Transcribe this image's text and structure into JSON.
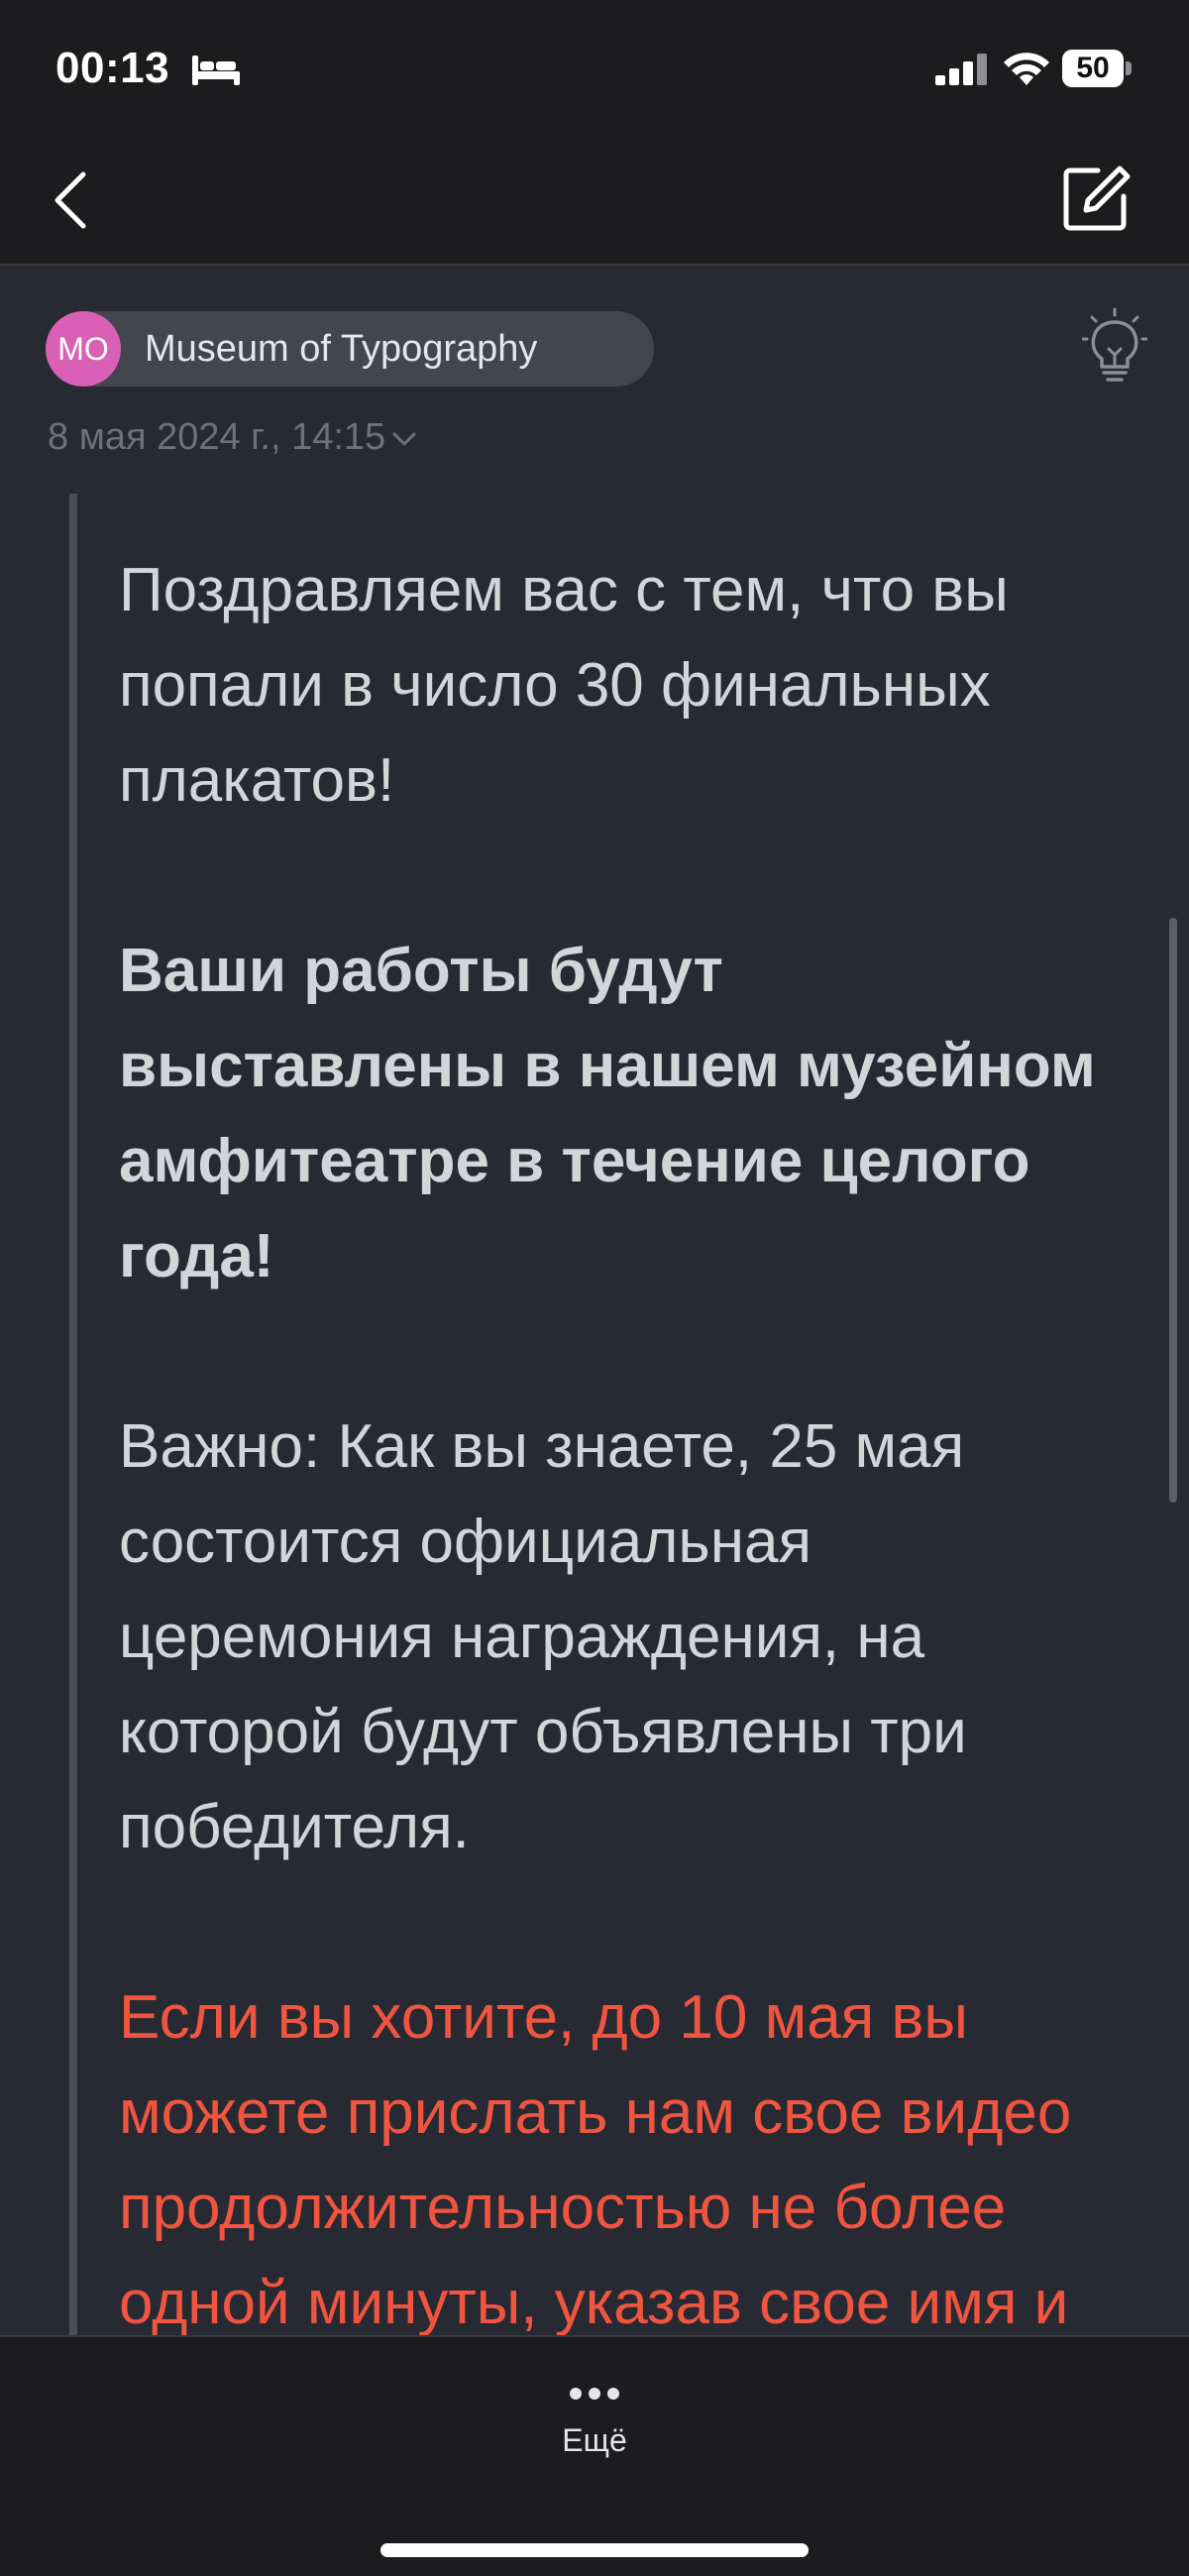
{
  "status_bar": {
    "time": "00:13",
    "battery": "50",
    "icons": [
      "bed-icon",
      "signal-icon",
      "wifi-icon",
      "battery-icon"
    ]
  },
  "nav": {
    "back_icon": "chevron-left-icon",
    "compose_icon": "compose-icon"
  },
  "message": {
    "sender_initials": "MO",
    "sender_name": "Museum of Typography",
    "date": "8 мая 2024 г., 14:15",
    "paragraphs": {
      "p1": "Поздравляем вас с тем, что вы попали в число 30 финальных плакатов!",
      "p2": "Ваши работы будут выставлены в нашем музейном амфитеатре в течение целого года!",
      "p3": "Важно: Как вы знаете, 25 мая состоится официальная церемония награждения, на которой будут объявлены три победителя.",
      "p4": "Если вы хотите, до 10 мая вы можете прислать нам свое видео продолжительностью не более одной минуты, указав свое имя и откуда вы"
    },
    "colors": {
      "highlight_red": "#f0553f",
      "avatar_bg": "#d960b5"
    }
  },
  "bottom_bar": {
    "more_label": "Ещё"
  }
}
